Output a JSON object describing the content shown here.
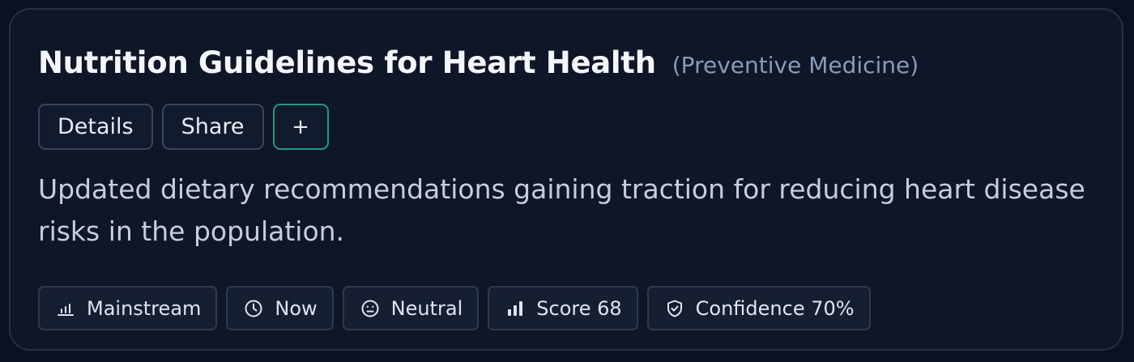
{
  "card": {
    "title": "Nutrition Guidelines for Heart Health",
    "category": "(Preventive Medicine)",
    "actions": {
      "details_label": "Details",
      "share_label": "Share",
      "add_label": "+"
    },
    "description": "Updated dietary recommendations gaining traction for reducing heart disease risks in the population.",
    "tags": [
      {
        "icon": "bar-chart-icon",
        "label": "Mainstream"
      },
      {
        "icon": "clock-icon",
        "label": "Now"
      },
      {
        "icon": "neutral-face-icon",
        "label": "Neutral"
      },
      {
        "icon": "score-bars-icon",
        "label": "Score 68"
      },
      {
        "icon": "shield-check-icon",
        "label": "Confidence 70%"
      }
    ]
  },
  "colors": {
    "background": "#0b1120",
    "card": "#0e1628",
    "accent": "#1f9b80",
    "title": "#f4f6fb",
    "muted": "#8b9ab5"
  }
}
